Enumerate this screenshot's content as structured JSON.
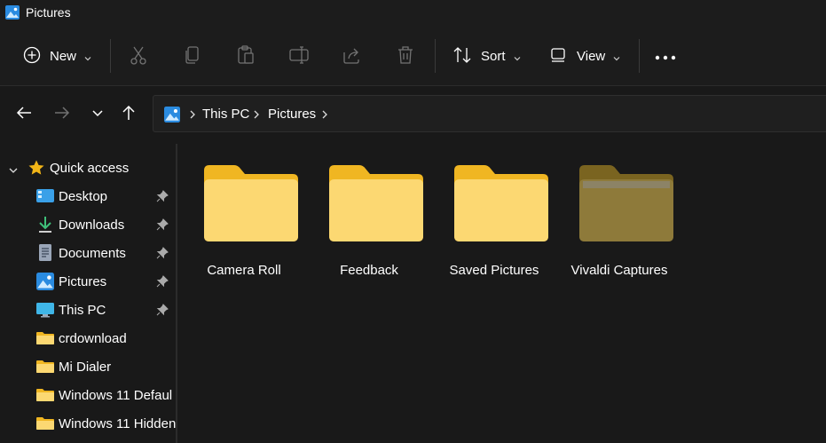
{
  "window": {
    "title": "Pictures",
    "icon": "pictures-icon"
  },
  "toolbar": {
    "new_label": "New",
    "sort_label": "Sort",
    "view_label": "View",
    "icons": [
      "new-plus-icon",
      "cut-icon",
      "copy-icon",
      "paste-icon",
      "rename-icon",
      "share-icon",
      "delete-icon",
      "sort-icon",
      "view-icon",
      "more-icon"
    ]
  },
  "address": {
    "crumbs": [
      "This PC",
      "Pictures"
    ]
  },
  "sidebar": {
    "items": [
      {
        "label": "Quick access",
        "icon": "star-icon"
      },
      {
        "label": "Desktop",
        "icon": "desktop-icon",
        "pinned": true
      },
      {
        "label": "Downloads",
        "icon": "download-icon",
        "pinned": true
      },
      {
        "label": "Documents",
        "icon": "document-icon",
        "pinned": true
      },
      {
        "label": "Pictures",
        "icon": "pictures-icon",
        "pinned": true
      },
      {
        "label": "This PC",
        "icon": "monitor-icon",
        "pinned": true
      },
      {
        "label": "crdownload",
        "icon": "folder-icon"
      },
      {
        "label": "Mi Dialer",
        "icon": "folder-icon"
      },
      {
        "label": "Windows 11 Defaul",
        "icon": "folder-icon"
      },
      {
        "label": "Windows 11 Hidden",
        "icon": "folder-icon"
      }
    ]
  },
  "folders": [
    {
      "name": "Camera Roll"
    },
    {
      "name": "Feedback"
    },
    {
      "name": "Saved Pictures"
    },
    {
      "name": "Vivaldi Captures"
    }
  ],
  "colors": {
    "folder_back": "#f0b622",
    "folder_front": "#fcd872",
    "folder_dim_back": "#7a6420",
    "folder_dim_front": "#8e7a3a",
    "accent_blue": "#3aa0e8",
    "star": "#f2b517"
  }
}
